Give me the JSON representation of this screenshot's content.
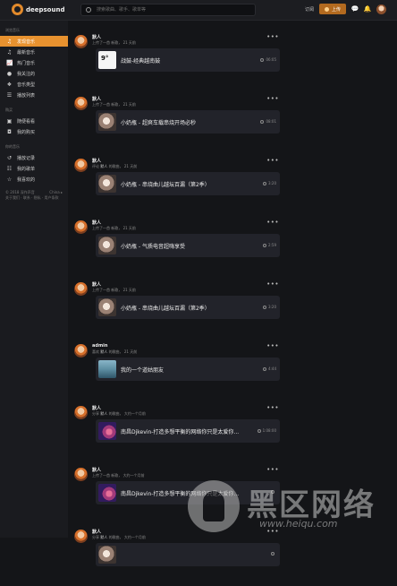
{
  "header": {
    "logo_text": "deepsound",
    "search_placeholder": "搜索歌曲、歌手、歌单等",
    "subscribe_label": "订阅",
    "upload_label": "上传",
    "message_icon": "chat-icon",
    "notification_icon": "bell-icon"
  },
  "sidebar": {
    "group1_title": "浏览音乐",
    "group1_items": [
      {
        "label": "发现音乐",
        "icon": "music-note-icon",
        "active": true
      },
      {
        "label": "最新音乐",
        "icon": "music-note-icon",
        "active": false
      },
      {
        "label": "热门音乐",
        "icon": "chart-icon",
        "active": false
      },
      {
        "label": "我关注的",
        "icon": "drop-icon",
        "active": false
      },
      {
        "label": "音乐类型",
        "icon": "genre-icon",
        "active": false
      },
      {
        "label": "播放列表",
        "icon": "playlist-icon",
        "active": false
      }
    ],
    "group2_title": "购买",
    "group2_items": [
      {
        "label": "随便看看",
        "icon": "shop-icon"
      },
      {
        "label": "我的购买",
        "icon": "bag-icon"
      }
    ],
    "group3_title": "你的音乐",
    "group3_items": [
      {
        "label": "播放记录",
        "icon": "history-icon"
      },
      {
        "label": "我的歌单",
        "icon": "list-icon"
      },
      {
        "label": "我喜欢的",
        "icon": "star-icon"
      }
    ],
    "footer_copyright": "© 2018 深作声音",
    "footer_language": "China ▸",
    "footer_links": "关于我们 · 联系 · 隐私 · 用户条款"
  },
  "feed": [
    {
      "user": "默人",
      "meta_prefix": "上传了一首",
      "meta_owner": "",
      "meta_mid": "新歌，",
      "meta_time": "21 天前",
      "title": "战鼓-经典越南鼓",
      "duration": "06:05",
      "cover": "white"
    },
    {
      "user": "默人",
      "meta_prefix": "上传了一首",
      "meta_owner": "",
      "meta_mid": "新歌，",
      "meta_time": "21 天前",
      "title": "小奶瓶 - 超爽车载串烧开场必秒",
      "duration": "08:01",
      "cover": "face"
    },
    {
      "user": "默人",
      "meta_prefix": "评论",
      "meta_owner": "默人",
      "meta_mid": "的歌曲，",
      "meta_time": "21 天前",
      "title": "小奶瓶 - 串烧曲儿越坛百漏（第2季）",
      "duration": "3:20",
      "cover": "face"
    },
    {
      "user": "默人",
      "meta_prefix": "上传了一首",
      "meta_owner": "",
      "meta_mid": "新歌，",
      "meta_time": "21 天前",
      "title": "小奶瓶 - 气质电音超嗨享受",
      "duration": "2:59",
      "cover": "face"
    },
    {
      "user": "默人",
      "meta_prefix": "上传了一首",
      "meta_owner": "",
      "meta_mid": "新歌，",
      "meta_time": "21 天前",
      "title": "小奶瓶 - 串烧曲儿越坛百漏（第2季）",
      "duration": "3:20",
      "cover": "face"
    },
    {
      "user": "admin",
      "meta_prefix": "喜欢",
      "meta_owner": "默人",
      "meta_mid": "的歌曲，",
      "meta_time": "21 天前",
      "title": "我的一个道姑朋友",
      "duration": "4:44",
      "cover": "sea"
    },
    {
      "user": "默人",
      "meta_prefix": "分享",
      "meta_owner": "默人",
      "meta_mid": "的歌曲，",
      "meta_time": "大约一个月前",
      "title": "南昌Djkevin-打造多想平衡的网络你只是太爱你...",
      "duration": "1:08:00",
      "cover": "purple"
    },
    {
      "user": "默人",
      "meta_prefix": "上传了一首",
      "meta_owner": "",
      "meta_mid": "新歌，",
      "meta_time": "大约一个月前",
      "title": "南昌Djkevin-打造多想平衡的网络你只是太爱你...",
      "duration": "",
      "cover": "purple"
    },
    {
      "user": "默人",
      "meta_prefix": "分享",
      "meta_owner": "默人",
      "meta_mid": "的歌曲，",
      "meta_time": "大约一个月前",
      "title": "",
      "duration": "",
      "cover": "face"
    }
  ],
  "watermark": {
    "title": "黑区网络",
    "url": "www.heiqu.com"
  },
  "colors": {
    "accent": "#e8922f",
    "background": "#141518",
    "card": "#22232a"
  }
}
